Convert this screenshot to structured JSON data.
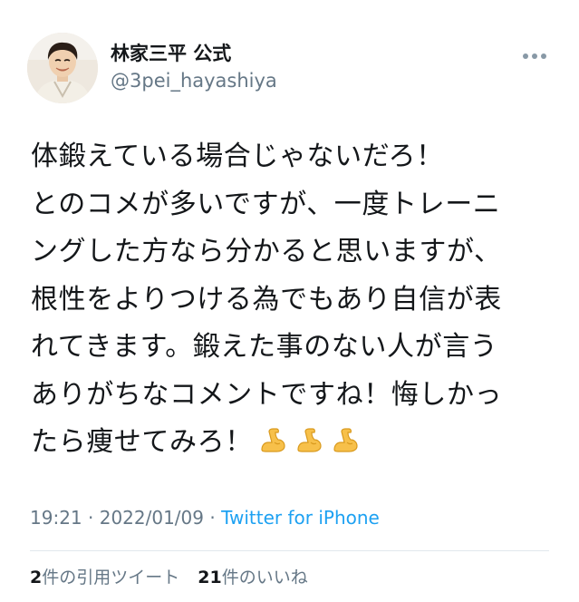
{
  "user": {
    "display_name": "林家三平 公式",
    "handle": "@3pei_hayashiya"
  },
  "tweet": {
    "lines": [
      "体鍛えている場合じゃないだろ！",
      "とのコメが多いですが、一度トレーニ",
      "ングした方なら分かると思いますが、",
      "根性をよりつける為でもあり自信が表",
      "れてきます。鍛えた事のない人が言う",
      "ありがちなコメントですね！悔しかっ",
      "たら痩せてみろ！"
    ],
    "emoji": [
      "flexed-biceps",
      "flexed-biceps",
      "flexed-biceps"
    ]
  },
  "meta": {
    "time": "19:21",
    "separator": "·",
    "date": "2022/01/09",
    "source": "Twitter for iPhone"
  },
  "stats": {
    "quote_count": "2",
    "quote_label": "件の引用ツイート",
    "like_count": "21",
    "like_label": "件のいいね"
  },
  "colors": {
    "text": "#14171a",
    "secondary": "#657786",
    "link": "#1da1f2",
    "divider": "#e1e8ed"
  }
}
